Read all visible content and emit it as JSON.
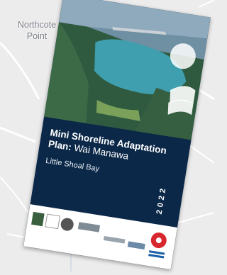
{
  "map": {
    "place_label_line1": "Northcote",
    "place_label_line2": "Point",
    "colors": {
      "land": "#ececed",
      "road": "#ffffff",
      "water": "#d6dde5"
    }
  },
  "document": {
    "title": "Mini Shoreline Adaptation Plan:",
    "subtitle": "Wai Manawa",
    "location": "Little Shoal Bay",
    "year": "2022",
    "colors": {
      "cover": "#0b2848",
      "accent_white": "#ffffff",
      "logo_red": "#d8262e"
    }
  }
}
